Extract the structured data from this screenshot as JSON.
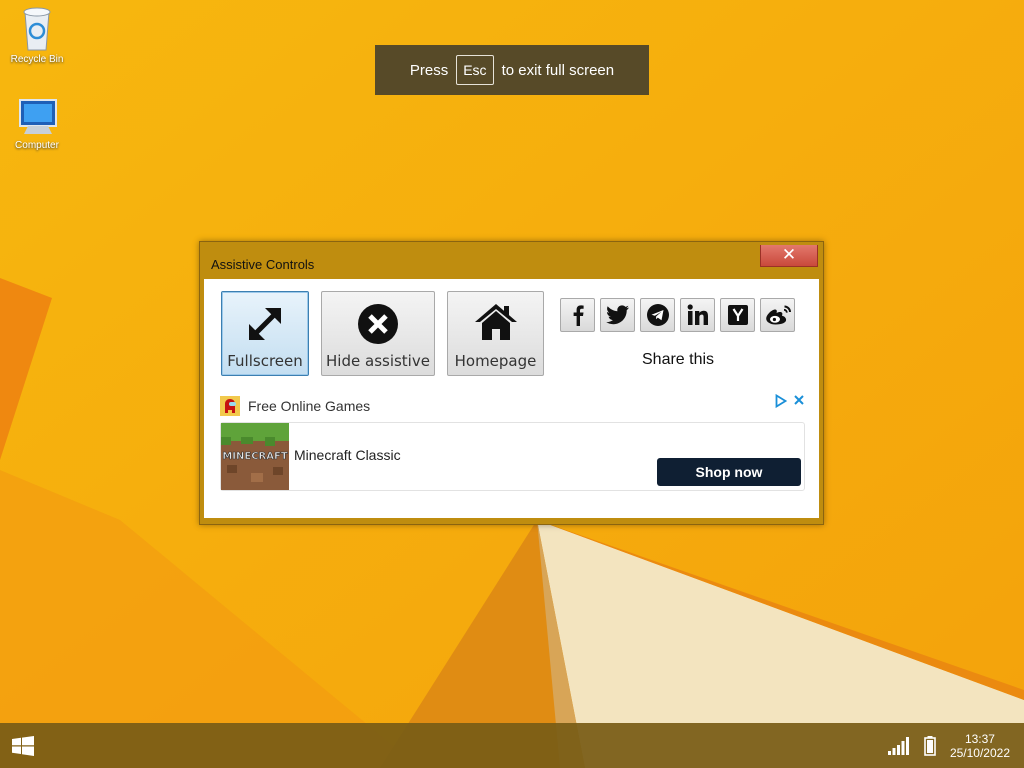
{
  "desktop": {
    "icons": [
      {
        "label": "Recycle Bin",
        "icon": "recycle-bin-icon"
      },
      {
        "label": "Computer",
        "icon": "computer-icon"
      }
    ]
  },
  "fullscreen_banner": {
    "prefix": "Press",
    "key": "Esc",
    "suffix": "to exit full screen"
  },
  "dialog": {
    "title": "Assistive Controls",
    "close_glyph": "✕",
    "buttons": [
      {
        "label": "Fullscreen",
        "icon": "expand-arrows-icon",
        "active": true
      },
      {
        "label": "Hide assistive",
        "icon": "close-circle-icon",
        "active": false
      },
      {
        "label": "Homepage",
        "icon": "home-icon",
        "active": false
      }
    ],
    "share": {
      "label": "Share this",
      "networks": [
        "facebook",
        "twitter",
        "telegram",
        "linkedin",
        "ycombinator",
        "weibo"
      ]
    },
    "ad": {
      "sponsor": "Free Online Games",
      "product": "Minecraft Classic",
      "thumb_text": "MINECRAFT",
      "cta": "Shop now"
    }
  },
  "taskbar": {
    "time": "13:37",
    "date": "25/10/2022"
  },
  "colors": {
    "wallpaper": "#f8b80e",
    "dialog_frame": "#bf8d0f",
    "close_button": "#d65a4c",
    "active_button": "#3c7fb1",
    "cta_button": "#0f1f33"
  }
}
